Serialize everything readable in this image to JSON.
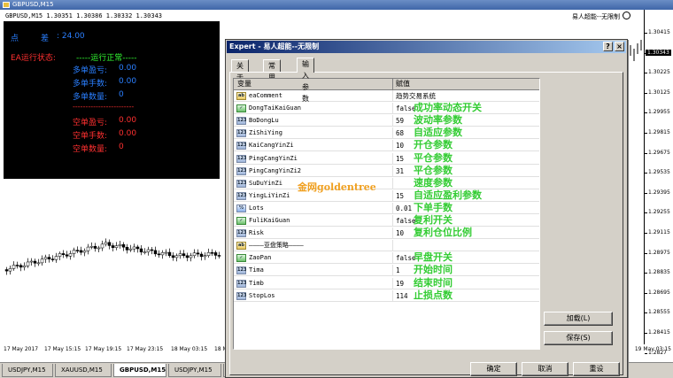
{
  "chart": {
    "window_title": "GBPUSD,M15",
    "ohlc_info": "GBPUSD,M15  1.30351 1.30386 1.30332 1.30343",
    "ea_name": "易人超能--无限制",
    "panel": {
      "points_label": "点",
      "spread_label": "差",
      "spread_value": ": 24.00",
      "ea_status_label": "EA运行状态:",
      "ea_status_value": "-----运行正常-----",
      "long_profit_label": "多单盈亏:",
      "long_profit_value": "0.00",
      "long_lots_label": "多单手数:",
      "long_lots_value": "0.00",
      "long_count_label": "多单数量:",
      "long_count_value": "0",
      "separator": "------------------------",
      "short_profit_label": "空单盈亏:",
      "short_profit_value": "0.00",
      "short_lots_label": "空单手数:",
      "short_lots_value": "0.00",
      "short_count_label": "空单数量:",
      "short_count_value": "0"
    },
    "price_ticks": [
      "1.30415",
      "1.30343",
      "1.30225",
      "1.30125",
      "1.29955",
      "1.29815",
      "1.29675",
      "1.29535",
      "1.29395",
      "1.29255",
      "1.29115",
      "1.28975",
      "1.28835",
      "1.28695",
      "1.28555",
      "1.28415",
      "1.2827"
    ],
    "current_price": "1.30343",
    "time_ticks": [
      "17 May 2017",
      "17 May 15:15",
      "17 May 19:15",
      "17 May 23:15",
      "18 May 03:15",
      "18 May 07:15",
      "19 May 03:15"
    ],
    "tabs": [
      "USDJPY,M15",
      "XAUUSD,M15",
      "GBPUSD,M15",
      "USDJPY,M15",
      "GBPUSD,M15"
    ],
    "active_tab": 2
  },
  "dialog": {
    "title": "Expert - 易人超能--无限制",
    "help_btn": "?",
    "close_btn": "×",
    "tabs": [
      "关于",
      "常用",
      "输入参数"
    ],
    "active_tab": 2,
    "col_var": "变量",
    "col_val": "赋值",
    "params": [
      {
        "icon": "ab",
        "name": "eaComment",
        "value": "趋势交易系统",
        "note": ""
      },
      {
        "icon": "bool",
        "name": "DongTaiKaiGuan",
        "value": "false",
        "note": "成功率动态开关"
      },
      {
        "icon": "123",
        "name": "BoDongLu",
        "value": "59",
        "note": "波动率参数"
      },
      {
        "icon": "123",
        "name": "ZiShiYing",
        "value": "68",
        "note": "自适应参数"
      },
      {
        "icon": "123",
        "name": "KaiCangYinZi",
        "value": "10",
        "note": "开仓参数"
      },
      {
        "icon": "123",
        "name": "PingCangYinZi",
        "value": "15",
        "note": "平仓参数"
      },
      {
        "icon": "123",
        "name": "PingCangYinZi2",
        "value": "31",
        "note": "平仓参数"
      },
      {
        "icon": "123",
        "name": "SuDuYinZi",
        "value": "",
        "note": "速度参数"
      },
      {
        "icon": "123",
        "name": "YingLiYinZi",
        "value": "15",
        "note": "自适应盈利参数"
      },
      {
        "icon": "½",
        "name": "Lots",
        "value": "0.01",
        "note": "下单手数"
      },
      {
        "icon": "bool",
        "name": "FuliKaiGuan",
        "value": "false",
        "note": "复利开关"
      },
      {
        "icon": "123",
        "name": "Risk",
        "value": "10",
        "note": "复利仓位比例"
      },
      {
        "icon": "ab",
        "name": "————亚盘策略————",
        "value": "",
        "note": ""
      },
      {
        "icon": "bool",
        "name": "ZaoPan",
        "value": "false",
        "note": "早盘开关"
      },
      {
        "icon": "123",
        "name": "Tima",
        "value": "1",
        "note": "开始时间"
      },
      {
        "icon": "123",
        "name": "Timb",
        "value": "19",
        "note": "结束时间"
      },
      {
        "icon": "123",
        "name": "StopLos",
        "value": "114",
        "note": "止损点数"
      }
    ],
    "watermark": "金网goldentree",
    "load_btn": "加载(L)",
    "save_btn": "保存(S)",
    "ok_btn": "确定",
    "cancel_btn": "取消",
    "reset_btn": "重设"
  },
  "colors": {
    "panel_blue": "#2a7fff",
    "panel_green": "#33ff33",
    "panel_red": "#ff3030",
    "annotation_green": "#33cc33"
  }
}
